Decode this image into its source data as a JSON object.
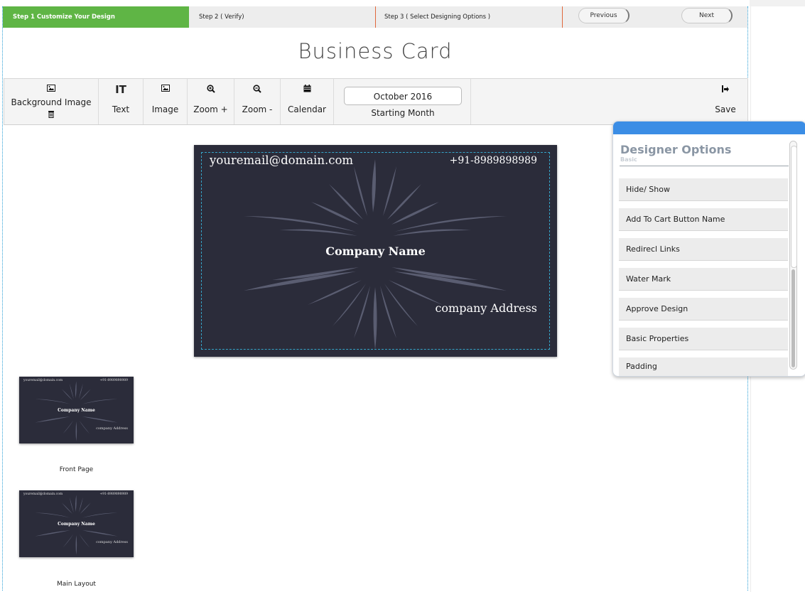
{
  "steps": [
    {
      "label": "Step 1 Customize Your Design",
      "active": true
    },
    {
      "label": "Step 2 ( Verify)",
      "active": false
    },
    {
      "label": "Step 3 ( Select Designing Options )",
      "active": false
    }
  ],
  "nav": {
    "previous": "Previous",
    "next": "Next"
  },
  "page_title": "Business Card",
  "toolbar": {
    "background_image": "Background Image",
    "text": "Text",
    "image": "Image",
    "zoom_in": "Zoom +",
    "zoom_out": "Zoom -",
    "calendar": "Calendar",
    "month_value": "October 2016",
    "month_label": "Starting Month",
    "save": "Save"
  },
  "card": {
    "email": "youremail@domain.com",
    "phone": "+91-8989898989",
    "company": "Company Name",
    "address": "company Address",
    "background_color": "#2b2c3a",
    "guide_color": "#35a5c9"
  },
  "thumbnails": [
    {
      "label": "Front Page",
      "email": "youremail@domain.com",
      "phone": "+91-8989898989",
      "company": "Company Name",
      "address": "company Address"
    },
    {
      "label": "Main Layout",
      "email": "youremail@domain.com",
      "phone": "+91-8989898989",
      "company": "Company Name",
      "address": "company Address"
    }
  ],
  "designer_panel": {
    "title": "Designer Options",
    "section": "Basic",
    "options": [
      "Hide/ Show",
      "Add To Cart Button Name",
      "Redirecl Links",
      "Water Mark",
      "Approve Design",
      "Basic Properties",
      "Padding"
    ]
  },
  "colors": {
    "step_active": "#5fb545",
    "panel_header": "#3b8de5",
    "step_divider": "#e0673b"
  }
}
